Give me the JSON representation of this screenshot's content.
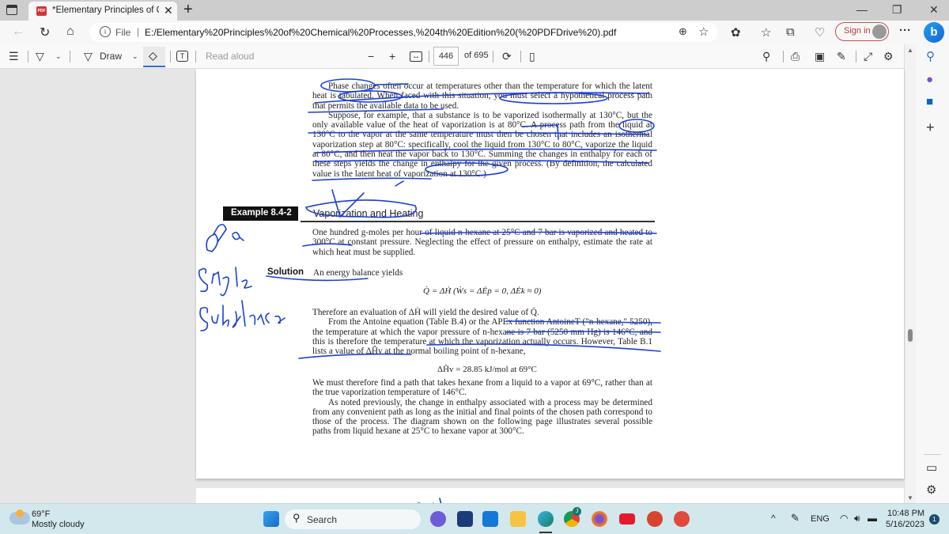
{
  "browser": {
    "tab": {
      "title": "*Elementary Principles of Chemic",
      "icon": "pdf-icon"
    },
    "address": {
      "scheme_label": "File",
      "url": "E:/Elementary%20Principles%20of%20Chemical%20Processes,%204th%20Edition%20(%20PDFDrive%20).pdf"
    },
    "sign_in_label": "Sign in",
    "more_label": "···"
  },
  "pdf_toolbar": {
    "draw_label": "Draw",
    "read_aloud_label": "Read aloud",
    "zoom_out": "−",
    "zoom_in": "+",
    "current_page": "446",
    "total_pages": "of 695"
  },
  "document": {
    "para1": "Phase changes often occur at temperatures other than the temperature for which the latent heat is tabulated. When faced with this situation, you must select a hypothetical process path that permits the available data to be used.",
    "para2": "Suppose, for example, that a substance is to be vaporized isothermally at 130°C, but the only available value of the heat of vaporization is at 80°C. A process path from the liquid at 130°C to the vapor at the same temperature must then be chosen that includes an isothermal vaporization step at 80°C: specifically, cool the liquid from 130°C to 80°C, vaporize the liquid at 80°C, and then heat the vapor back to 130°C. Summing the changes in enthalpy for each of these steps yields the change in enthalpy for the given process. (By definition, the calculated value is the latent heat of vaporization at 130°C.)",
    "example_label": "Example 8.4-2",
    "example_title": "Vaporization and Heating",
    "example_problem": "One hundred g-moles per hour of liquid n-hexane at 25°C and 7 bar is vaporized and heated to 300°C at constant pressure. Neglecting the effect of pressure on enthalpy, estimate the rate at which heat must be supplied.",
    "solution_label": "Solution",
    "solution_intro": "An energy balance yields",
    "equation1": "Q̇ = ΔḢ   (Ẇs = ΔĖp = 0, ΔĖk ≈ 0)",
    "para3": "Therefore an evaluation of ΔḢ will yield the desired value of Q̇.",
    "para4": "From the Antoine equation (Table B.4) or the APEx function AntoineT (\"n-hexane,\" 5250), the temperature at which the vapor pressure of n-hexane is 7 bar (5250 mm Hg) is 146°C, and this is therefore the temperature at which the vaporization actually occurs. However, Table B.1 lists a value of ΔĤv at the normal boiling point of n-hexane,",
    "equation2": "ΔĤv = 28.85 kJ/mol at 69°C",
    "para5": "We must therefore find a path that takes hexane from a liquid to a vapor at 69°C, rather than at the true vaporization temperature of 146°C.",
    "para6": "As noted previously, the change in enthalpy associated with a process may be determined from any convenient path as long as the initial and final points of the chosen path correspond to those of the process. The diagram shown on the following page illustrates several possible paths from liquid hexane at 25°C to hexane vapor at 300°C.",
    "handwritten_note": "of a Single Substance"
  },
  "taskbar": {
    "weather_temp": "69°F",
    "weather_desc": "Mostly cloudy",
    "search_label": "Search",
    "language": "ENG",
    "time": "10:48 PM",
    "date": "5/16/2023",
    "notification_count": "1",
    "chrome_badge": "J"
  },
  "colors": {
    "ink": "#1a3fd6",
    "signin_border": "#c0504d",
    "taskbar_bg": "#d2e8ec"
  }
}
